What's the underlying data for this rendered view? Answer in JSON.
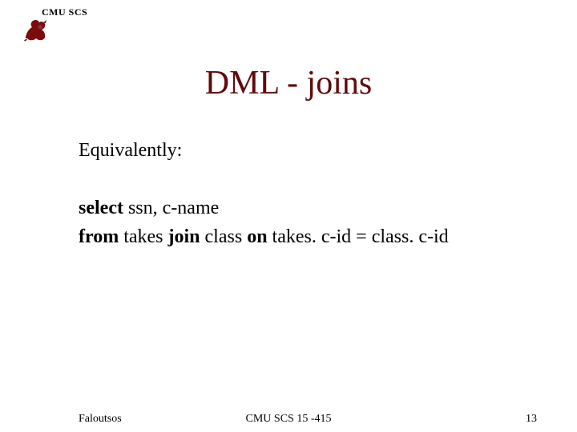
{
  "header": {
    "label": "CMU SCS"
  },
  "title": "DML - joins",
  "body": {
    "intro": "Equivalently:",
    "line1_kw": "select",
    "line1_rest": " ssn, c-name",
    "line2_kw1": "from",
    "line2_mid1": " takes ",
    "line2_kw2": "join",
    "line2_mid2": " class ",
    "line2_kw3": "on",
    "line2_rest": " takes. c-id = class. c-id"
  },
  "footer": {
    "left": "Faloutsos",
    "center": "CMU SCS 15 -415",
    "right": "13"
  }
}
